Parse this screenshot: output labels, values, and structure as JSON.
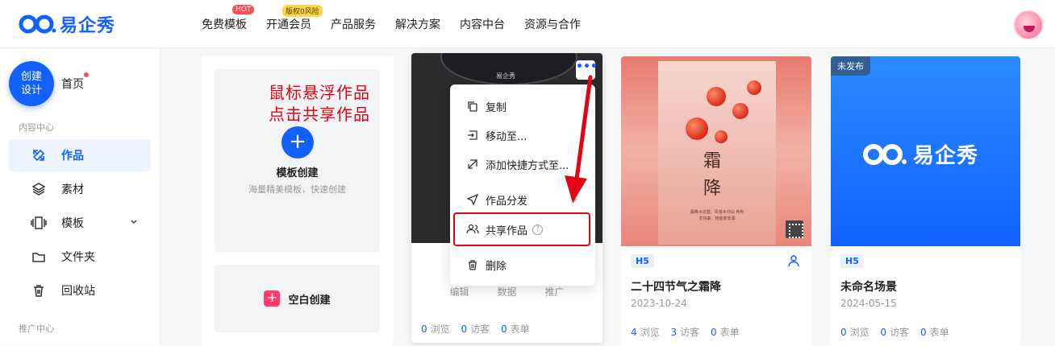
{
  "brand": {
    "name": "易企秀",
    "color": "#1261ff"
  },
  "nav": [
    {
      "label": "免费模板",
      "badge": "HOT"
    },
    {
      "label": "开通会员",
      "badge": "版权0风险"
    },
    {
      "label": "产品服务",
      "badge": null
    },
    {
      "label": "解决方案",
      "badge": null
    },
    {
      "label": "内容中台",
      "badge": null
    },
    {
      "label": "资源与合作",
      "badge": null
    }
  ],
  "sidebar": {
    "create_label": "创建\n设计",
    "home": "首页",
    "section_content": "内容中心",
    "section_promo": "推广中心",
    "items": [
      {
        "label": "作品",
        "icon": "works-icon",
        "active": true
      },
      {
        "label": "素材",
        "icon": "layers-icon",
        "active": false
      },
      {
        "label": "模板",
        "icon": "template-icon",
        "active": false,
        "expandable": true
      },
      {
        "label": "文件夹",
        "icon": "folder-icon",
        "active": false
      },
      {
        "label": "回收站",
        "icon": "trash-icon",
        "active": false
      }
    ]
  },
  "template_card": {
    "title": "模板创建",
    "subtitle": "海量精美模板，快速创建",
    "blank_label": "空白创建"
  },
  "annotation": {
    "line1": "鼠标悬浮作品",
    "line2": "点击共享作品"
  },
  "context_menu": {
    "items": [
      {
        "label": "复制",
        "icon": "copy-icon"
      },
      {
        "label": "移动至...",
        "icon": "move-icon"
      },
      {
        "label": "添加快捷方式至...",
        "icon": "shortcut-icon"
      },
      {
        "label": "作品分发",
        "icon": "send-icon"
      },
      {
        "label": "共享作品",
        "icon": "users-icon"
      },
      {
        "label": "删除",
        "icon": "trash-icon"
      }
    ]
  },
  "work1": {
    "cover_logo": "易企秀",
    "actions": [
      "编辑",
      "数据",
      "推广"
    ],
    "views": "0",
    "views_label": "浏览",
    "visitors": "0",
    "visitors_label": "访客",
    "forms": "0",
    "forms_label": "表单"
  },
  "work2": {
    "tag": "H5",
    "title": "二十四节气之霜降",
    "date": "2023-10-24",
    "poster_char1": "霜",
    "poster_char2": "降",
    "poster_text": "霜降水返壑，风落木归山 冉冉岁将宴，物皆复本源",
    "views": "4",
    "views_label": "浏览",
    "visitors": "3",
    "visitors_label": "访客",
    "forms": "0",
    "forms_label": "表单"
  },
  "work3": {
    "badge": "未发布",
    "cover_logo": "易企秀",
    "tag": "H5",
    "title": "未命名场景",
    "date": "2024-05-15",
    "views": "0",
    "views_label": "浏览",
    "visitors": "0",
    "visitors_label": "访客",
    "forms": "0",
    "forms_label": "表单"
  }
}
